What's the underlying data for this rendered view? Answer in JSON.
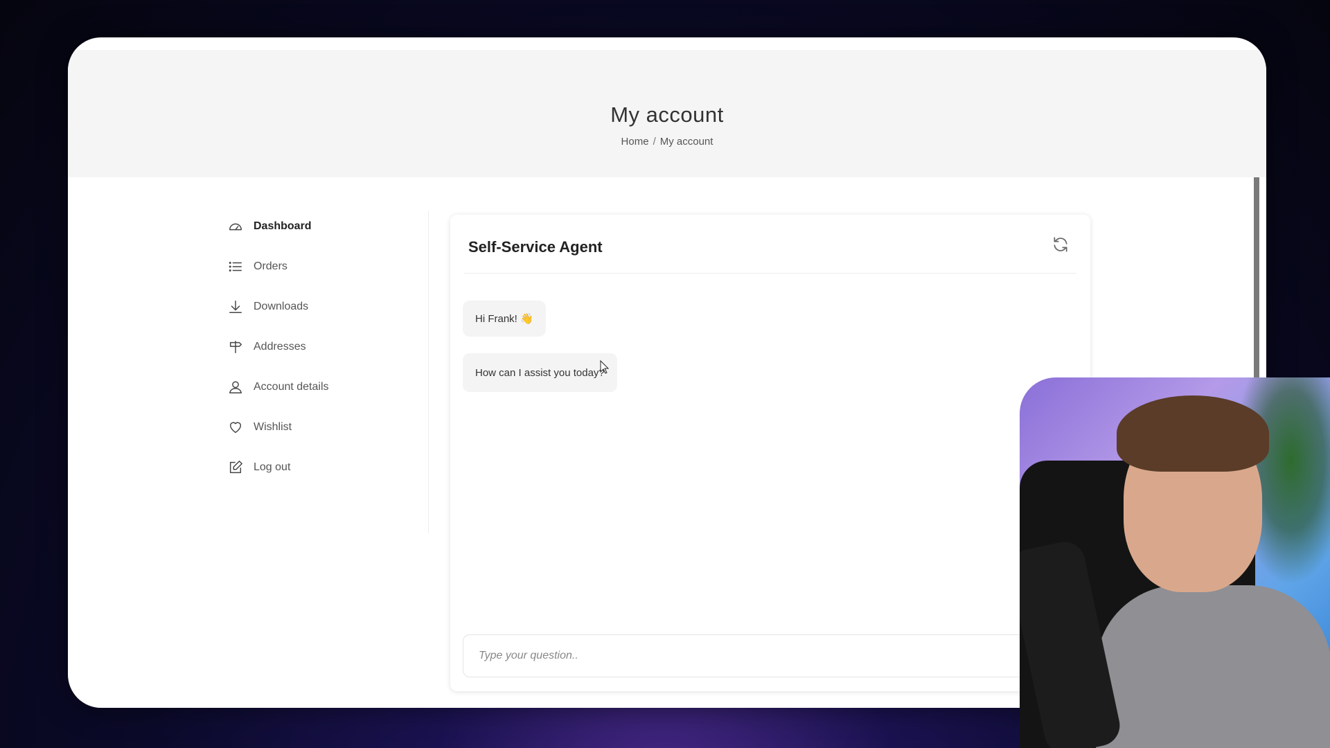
{
  "page": {
    "title": "My account",
    "breadcrumb": {
      "home": "Home",
      "separator": "/",
      "current": "My account"
    }
  },
  "sidebar": {
    "items": [
      {
        "label": "Dashboard",
        "icon": "dashboard-icon",
        "active": true
      },
      {
        "label": "Orders",
        "icon": "list-icon",
        "active": false
      },
      {
        "label": "Downloads",
        "icon": "download-icon",
        "active": false
      },
      {
        "label": "Addresses",
        "icon": "signpost-icon",
        "active": false
      },
      {
        "label": "Account details",
        "icon": "user-icon",
        "active": false
      },
      {
        "label": "Wishlist",
        "icon": "heart-icon",
        "active": false
      },
      {
        "label": "Log out",
        "icon": "edit-icon",
        "active": false
      }
    ]
  },
  "chat": {
    "title": "Self-Service Agent",
    "refresh_icon": "refresh-icon",
    "messages": [
      {
        "text": "Hi Frank! 👋"
      },
      {
        "text": "How can I assist you today?"
      }
    ],
    "input_placeholder": "Type your question.."
  },
  "colors": {
    "background": "#0b0a2a",
    "panel": "#ffffff",
    "header": "#f5f5f5",
    "bubble": "#f4f4f4",
    "text": "#333333"
  }
}
